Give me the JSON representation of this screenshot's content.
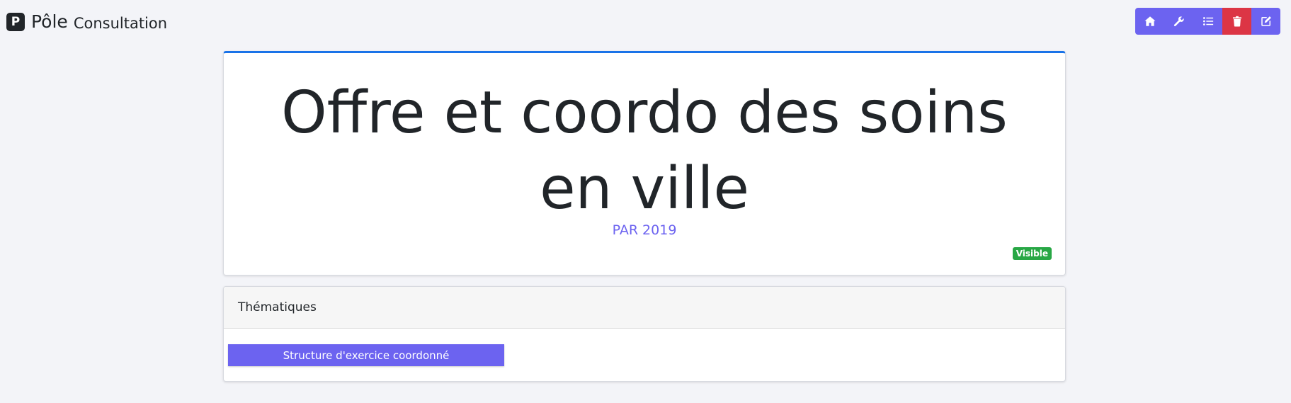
{
  "brand": {
    "logo_letter": "P",
    "title": "Pôle",
    "subtitle": "Consultation"
  },
  "toolbar": {
    "buttons": [
      {
        "icon": "home-icon",
        "color": "#6c63f0"
      },
      {
        "icon": "wrench-icon",
        "color": "#6c63f0"
      },
      {
        "icon": "list-icon",
        "color": "#6c63f0"
      },
      {
        "icon": "trash-icon",
        "color": "#dc3545"
      },
      {
        "icon": "edit-icon",
        "color": "#6c63f0"
      }
    ]
  },
  "offer": {
    "title": "Offre et coordo des soins en ville",
    "subtitle": "PAR 2019",
    "status_badge": "Visible",
    "accent_color": "#1a73e8"
  },
  "themes": {
    "header": "Thématiques",
    "items": [
      {
        "label": "Structure d'exercice coordonné"
      }
    ]
  },
  "colors": {
    "primary": "#6c63f0",
    "danger": "#dc3545",
    "success": "#28a745"
  }
}
